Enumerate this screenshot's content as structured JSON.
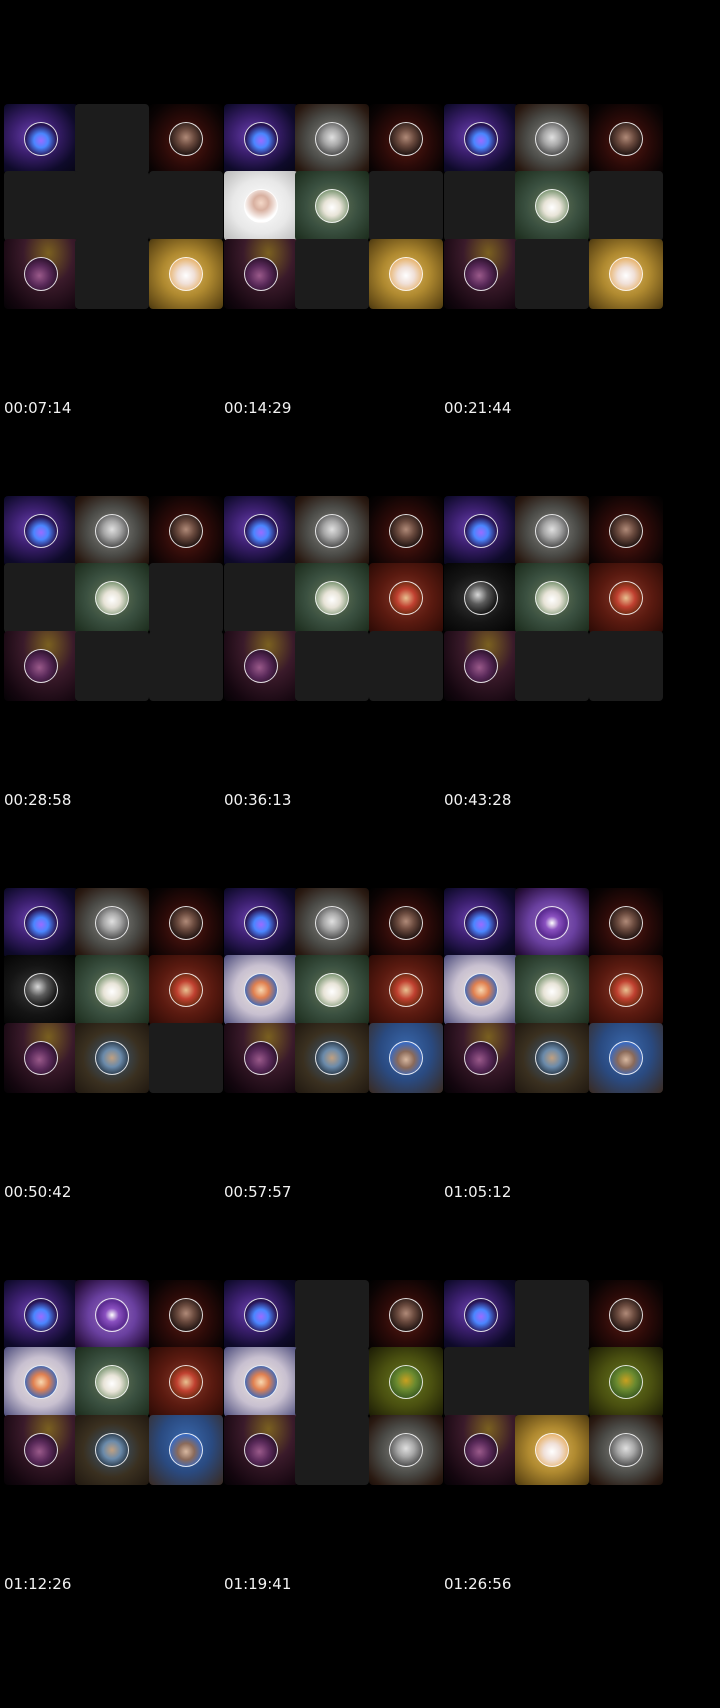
{
  "contact_sheet": {
    "frames": [
      {
        "timestamp": "00:07:14",
        "tiles": [
          "neon-logo",
          "empty",
          "woman-dark",
          "empty",
          "empty",
          "empty",
          "woman-purple",
          "empty",
          "bunny-gold"
        ]
      },
      {
        "timestamp": "00:14:29",
        "tiles": [
          "neon-logo",
          "man-gray",
          "woman-dark",
          "man-bald-white",
          "llama-green",
          "empty",
          "woman-purple",
          "empty",
          "bunny-gold"
        ]
      },
      {
        "timestamp": "00:21:44",
        "tiles": [
          "neon-logo",
          "man-gray",
          "woman-dark",
          "empty",
          "llama-green",
          "empty",
          "woman-purple",
          "empty",
          "bunny-gold"
        ]
      },
      {
        "timestamp": "00:28:58",
        "tiles": [
          "neon-logo",
          "man-gray",
          "woman-dark",
          "empty",
          "llama-green",
          "empty",
          "woman-purple",
          "empty",
          "empty"
        ]
      },
      {
        "timestamp": "00:36:13",
        "tiles": [
          "neon-logo",
          "man-gray",
          "woman-dark",
          "empty",
          "llama-green",
          "couple-red",
          "woman-purple",
          "empty",
          "empty"
        ]
      },
      {
        "timestamp": "00:43:28",
        "tiles": [
          "neon-logo",
          "man-gray",
          "woman-dark",
          "bw-portrait",
          "llama-green",
          "couple-red",
          "woman-purple",
          "empty",
          "empty"
        ]
      },
      {
        "timestamp": "00:50:42",
        "tiles": [
          "neon-logo",
          "man-gray",
          "woman-dark",
          "bw-portrait",
          "llama-green",
          "couple-red",
          "woman-purple",
          "man-blue",
          "empty"
        ]
      },
      {
        "timestamp": "00:57:57",
        "tiles": [
          "neon-logo",
          "man-gray",
          "woman-dark",
          "cartoon-man",
          "llama-green",
          "couple-red",
          "woman-purple",
          "man-blue",
          "man-sky"
        ]
      },
      {
        "timestamp": "01:05:12",
        "tiles": [
          "neon-logo",
          "purple-badge",
          "woman-dark",
          "cartoon-man",
          "llama-green",
          "couple-red",
          "woman-purple",
          "man-blue",
          "man-sky"
        ]
      },
      {
        "timestamp": "01:12:26",
        "tiles": [
          "neon-logo",
          "purple-badge",
          "woman-dark",
          "cartoon-man",
          "llama-green",
          "couple-red",
          "woman-purple",
          "man-blue",
          "man-sky"
        ]
      },
      {
        "timestamp": "01:19:41",
        "tiles": [
          "neon-logo",
          "empty",
          "woman-dark",
          "cartoon-man",
          "empty",
          "soldier-green",
          "woman-purple",
          "empty",
          "man-gray"
        ]
      },
      {
        "timestamp": "01:26:56",
        "tiles": [
          "neon-logo",
          "empty",
          "woman-dark",
          "empty",
          "empty",
          "soldier-green",
          "woman-purple",
          "bunny-gold",
          "man-gray"
        ]
      }
    ]
  },
  "avatar_styles": {
    "neon-logo": {
      "bg": "radial-gradient(ellipse at 40% 45%, #6a3fb0 0%, #3b1f6e 35%, #0e0a2a 70%, #050510 100%)",
      "avatar": "radial-gradient(circle at 50% 55%, #9b6cff 0%, #4a86ff 30%, #2a1658 65%, #0b0820 100%)",
      "label": "neon-logo-avatar"
    },
    "woman-dark": {
      "bg": "radial-gradient(ellipse at 50% 55%, #5a1a12 0%, #2a0a08 45%, #0a0303 80%, #000 100%)",
      "avatar": "radial-gradient(circle at 50% 45%, #b08a78 0%, #6a4a3e 35%, #1e1210 75%, #0a0505 100%)",
      "label": "woman-dark-avatar"
    },
    "woman-purple": {
      "bg": "radial-gradient(ellipse at 60% 20%, #7a6020 0%, #3a1a2a 40%, #14060f 80%, #050205 100%)",
      "avatar": "radial-gradient(circle at 45% 55%, #9a5a8a 0%, #5a2a5a 40%, #2a102a 75%, #e8c070 100%)",
      "label": "woman-purple-avatar"
    },
    "bunny-gold": {
      "bg": "radial-gradient(ellipse at 50% 50%, #e0b860 0%, #b08a30 45%, #6a5018 85%, #4a3810 100%)",
      "avatar": "radial-gradient(circle at 50% 55%, #ffffff 0%, #f0e0d8 35%, #e8b878 70%, #c89048 100%)",
      "label": "bunny-gold-avatar"
    },
    "man-gray": {
      "bg": "radial-gradient(ellipse at 50% 50%, #8a8a86 0%, #4a4a46 50%, #2a1a12 85%, #1a0e08 100%)",
      "avatar": "radial-gradient(circle at 50% 45%, #e0e0e0 0%, #a8a8a8 35%, #5a5a5a 70%, #303030 100%)",
      "label": "man-gray-avatar"
    },
    "man-bald-white": {
      "bg": "radial-gradient(ellipse at 50% 50%, #ffffff 0%, #e8e8e8 55%, #b8b8b8 100%)",
      "avatar": "radial-gradient(circle at 50% 40%, #f4d8c8 0%, #d8b0a0 30%, #ffffff 70%, #ffffff 100%)",
      "label": "man-bald-avatar"
    },
    "llama-green": {
      "bg": "radial-gradient(ellipse at 50% 50%, #6a7a5a 0%, #3a5040 50%, #1a2a1a 100%)",
      "avatar": "radial-gradient(circle at 50% 55%, #ffffff 0%, #e8e4d8 35%, #8aa080 70%, #4a6a4a 100%)",
      "label": "llama-avatar"
    },
    "couple-red": {
      "bg": "radial-gradient(ellipse at 50% 50%, #8a3a2a 0%, #5a1a10 50%, #2a0a05 100%)",
      "avatar": "radial-gradient(circle at 50% 50%, #e8c090 0%, #c04030 40%, #6a2a10 75%, #3a1005 100%)",
      "label": "couple-avatar"
    },
    "bw-portrait": {
      "bg": "radial-gradient(ellipse at 45% 50%, #3a3a3a 0%, #141414 50%, #000 100%)",
      "avatar": "radial-gradient(circle at 40% 40%, #d8d8d8 0%, #5a5a5a 35%, #101010 75%, #000 100%)",
      "label": "bw-portrait-avatar"
    },
    "man-blue": {
      "bg": "radial-gradient(ellipse at 50% 50%, #3a5a7a 0%, #3a3020 55%, #201810 100%)",
      "avatar": "radial-gradient(circle at 50% 50%, #c0a080 0%, #6a8aaa 40%, #2a3a4a 75%, #1a1a1a 100%)",
      "label": "man-blue-avatar"
    },
    "man-sky": {
      "bg": "radial-gradient(ellipse at 50% 40%, #3a6ab0 0%, #2a4a80 50%, #3a2a20 100%)",
      "avatar": "radial-gradient(circle at 50% 55%, #d8b8a0 0%, #8a6a5a 35%, #3a6ac0 70%, #2a50a0 100%)",
      "label": "man-sky-avatar"
    },
    "cartoon-man": {
      "bg": "radial-gradient(ellipse at 50% 50%, #f0e8e0 0%, #c8c0d0 50%, #4a4a7a 100%)",
      "avatar": "radial-gradient(circle at 50% 50%, #f8d8b0 0%, #e08050 35%, #4a6ab0 70%, #ffffff 100%)",
      "label": "cartoon-avatar"
    },
    "purple-badge": {
      "bg": "radial-gradient(ellipse at 50% 50%, #9a70c0 0%, #6a40a0 45%, #2a1040 85%, #100818 100%)",
      "avatar": "radial-gradient(circle at 50% 50%, #ffffff 0%, #8a50c0 30%, #5a2a90 65%, #ffffff 100%)",
      "label": "purple-badge-avatar"
    },
    "soldier-green": {
      "bg": "radial-gradient(ellipse at 50% 50%, #6a7a20 0%, #4a5010 50%, #1a1a05 100%)",
      "avatar": "radial-gradient(circle at 50% 45%, #c8a020 0%, #6a8a30 40%, #3a5a20 75%, #1a2a10 100%)",
      "label": "soldier-avatar"
    }
  }
}
